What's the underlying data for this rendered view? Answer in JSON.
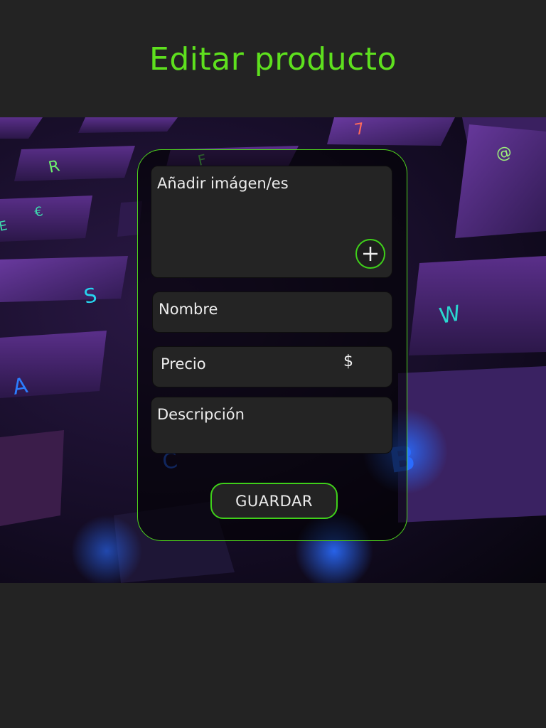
{
  "header": {
    "title": "Editar producto"
  },
  "form": {
    "images_label": "Añadir imágen/es",
    "add_image_icon": "plus-icon",
    "name_label": "Nombre",
    "price_label": "Precio",
    "currency_symbol": "$",
    "description_label": "Descripción",
    "save_label": "GUARDAR"
  },
  "colors": {
    "accent": "#5ee01e",
    "background": "#232323",
    "field_background": "#242424",
    "text": "#ededed"
  }
}
